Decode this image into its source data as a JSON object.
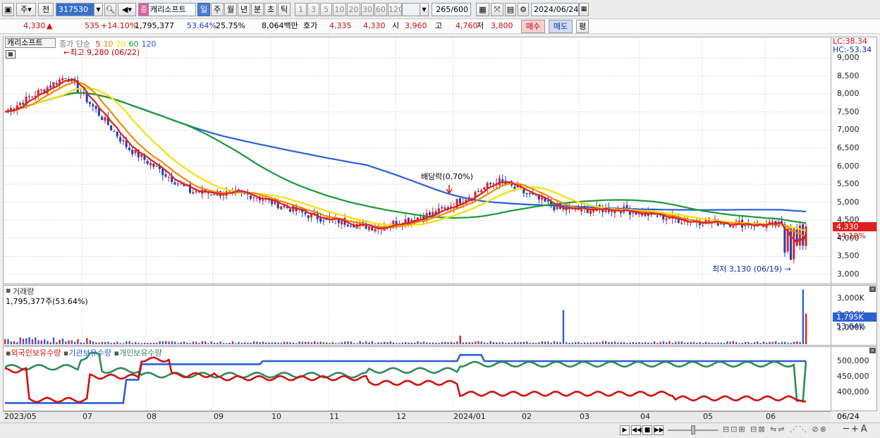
{
  "toolbar": {
    "market_btn": "주",
    "type_btn": "전",
    "code": "317530",
    "stock_name_tag": "종",
    "stock_name": "캐리소프트",
    "periods": [
      "일",
      "주",
      "월",
      "년",
      "분",
      "초",
      "틱"
    ],
    "active_period": "일",
    "multipliers": [
      "1",
      "3",
      "5",
      "10",
      "20",
      "30",
      "60",
      "120"
    ],
    "count": "265/600",
    "date": "2024/06/24"
  },
  "quote": {
    "price": "4,330",
    "arrow": "▲",
    "change": "535",
    "change_pct": "+14.10%",
    "volume": "1,795,377",
    "vol_ratio": "53.64%",
    "turnover": "25.75%",
    "amount": "8,064백만",
    "hoga_label": "호가",
    "ask": "4,335",
    "bid": "4,330",
    "open_label": "시",
    "open": "3,960",
    "high_label": "고",
    "high": "4,760",
    "low_label": "저",
    "low": "3,800",
    "buy_btn": "매수",
    "sell_btn": "매도",
    "avg_btn": "평"
  },
  "price_panel": {
    "name_box": "캐리소프트",
    "legend_label": "종가 단순",
    "ma_periods": [
      "5",
      "10",
      "20",
      "60",
      "120"
    ],
    "ma_colors": [
      "#e02020",
      "#f08a00",
      "#f5e000",
      "#1a9a3a",
      "#2a5fd8"
    ],
    "high_annotation": "최고 9,280 (06/22)",
    "low_annotation": "최저 3,130 (06/19)",
    "dividend_annotation": "배당락(0.70%)",
    "lc_label": "LC:38.34",
    "hc_label": "HC:-53.34",
    "price_tag": "4,330",
    "pct_tag": "14.10%",
    "y_ticks": [
      "9,000",
      "8,500",
      "8,000",
      "7,500",
      "7,000",
      "6,500",
      "6,000",
      "5,500",
      "5,000",
      "4,500",
      "4,000",
      "3,500",
      "3,000"
    ]
  },
  "volume_panel": {
    "title": "거래량",
    "value_line": "1,795,377주(53.64%)",
    "y_ticks": [
      "3,000K",
      "2,000K",
      "1,000K"
    ],
    "tag_value": "1,795K",
    "tag_pct": "53.64%"
  },
  "holdings_panel": {
    "legend": [
      "외국인보유수량",
      "기관보유수량",
      "개인보유수량"
    ],
    "legend_colors": [
      "#d01010",
      "#2a5fd8",
      "#2e8b57"
    ],
    "y_ticks": [
      "500,000",
      "450,000",
      "400,000"
    ]
  },
  "x_axis": {
    "labels": [
      "2023/05",
      "07",
      "08",
      "09",
      "10",
      "11",
      "12",
      "2024/01",
      "02",
      "03",
      "04",
      "05",
      "06"
    ],
    "end_label": "06/24"
  },
  "chart_data": {
    "type": "candlestick",
    "title": "캐리소프트",
    "period": "daily",
    "ylim": [
      3000,
      9300
    ],
    "annotated_high": {
      "value": 9280,
      "date": "06/22"
    },
    "annotated_low": {
      "value": 3130,
      "date": "06/19"
    },
    "months": [
      "2023/05",
      "07",
      "08",
      "09",
      "10",
      "11",
      "12",
      "2024/01",
      "02",
      "03",
      "04",
      "05",
      "06"
    ],
    "close_series_approx": [
      {
        "x": "2023/05",
        "y": 7500
      },
      {
        "x": "2023/06",
        "y": 8500
      },
      {
        "x": "2023/07",
        "y": 6500
      },
      {
        "x": "2023/08",
        "y": 5300
      },
      {
        "x": "2023/09",
        "y": 5200
      },
      {
        "x": "2023/10",
        "y": 4600
      },
      {
        "x": "2023/11",
        "y": 4300
      },
      {
        "x": "2023/12",
        "y": 4700
      },
      {
        "x": "2024/01",
        "y": 5600
      },
      {
        "x": "2024/02",
        "y": 4800
      },
      {
        "x": "2024/03",
        "y": 4800
      },
      {
        "x": "2024/04",
        "y": 4500
      },
      {
        "x": "2024/05",
        "y": 4400
      },
      {
        "x": "2024/06",
        "y": 4330
      }
    ],
    "last": {
      "close": 4330,
      "open": 3960,
      "high": 4760,
      "low": 3800,
      "volume": 1795377
    }
  }
}
